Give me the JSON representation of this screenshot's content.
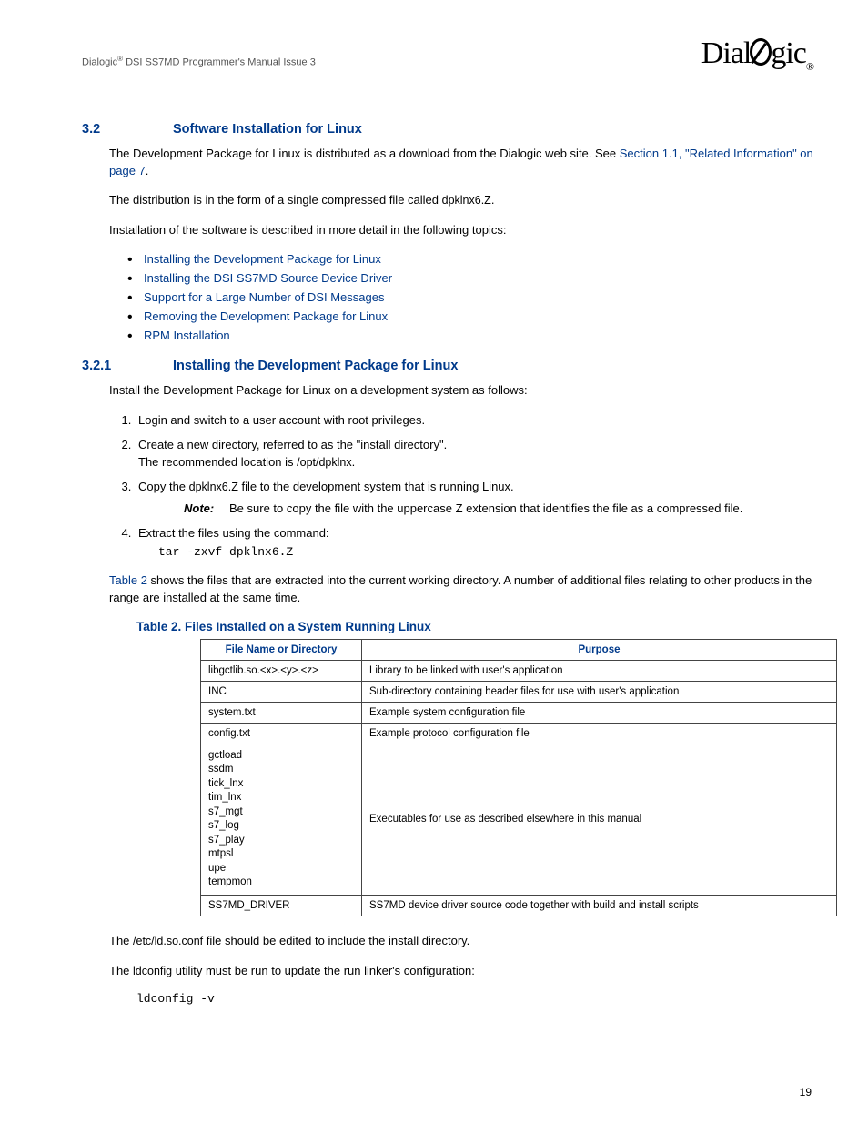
{
  "header": {
    "brand": "Dialogic",
    "doc": " DSI SS7MD Programmer's Manual  Issue 3",
    "logo_text_pre": "Dial",
    "logo_text_post": "gic",
    "reg": "®"
  },
  "s32": {
    "num": "3.2",
    "title": "Software Installation for Linux",
    "p1_a": "The Development Package for Linux is distributed as a download from the Dialogic web site. See ",
    "p1_link": "Section 1.1, \"Related Information\" on page 7",
    "p1_b": ".",
    "p2_a": "The distribution is in the form of a single compressed file called ",
    "p2_code": "dpklnx6.Z",
    "p2_b": ".",
    "p3": "Installation of the software is described in more detail in the following topics:",
    "bullets": [
      "Installing the Development Package for Linux",
      "Installing the DSI SS7MD Source Device Driver",
      "Support for a Large Number of DSI Messages",
      "Removing the Development Package for Linux",
      "RPM Installation"
    ]
  },
  "s321": {
    "num": "3.2.1",
    "title": "Installing the Development Package for Linux",
    "intro": "Install the Development Package for Linux on a development system as follows:",
    "steps": {
      "s1": "Login and switch to a user account with root privileges.",
      "s2_a": "Create a new directory, referred to as the \"install directory\".",
      "s2_b_pre": "The recommended location is ",
      "s2_b_code": "/opt/dpklnx",
      "s2_b_post": ".",
      "s3_pre": "Copy the ",
      "s3_code": "dpklnx6.Z",
      "s3_post": " file to the development system that is running Linux.",
      "note_label": "Note:",
      "note": "Be sure to copy the file with the uppercase Z extension that identifies the file as a compressed file.",
      "s4": "Extract the files using the command:",
      "s4_cmd": "tar -zxvf dpklnx6.Z"
    },
    "after_pre": "",
    "after_link": "Table 2",
    "after_post": " shows the files that are extracted into the current working directory. A number of additional files relating to other products in the range are installed at the same time."
  },
  "table": {
    "caption": "Table 2.  Files Installed on a System Running Linux",
    "h1": "File Name or Directory",
    "h2": "Purpose",
    "rows": [
      {
        "c1": "libgctlib.so.<x>.<y>.<z>",
        "c2": "Library to be linked with user's application"
      },
      {
        "c1": "INC",
        "c2": "Sub-directory containing header files for use with user's application"
      },
      {
        "c1": "system.txt",
        "c2": "Example system configuration file"
      },
      {
        "c1": "config.txt",
        "c2": "Example protocol configuration file"
      },
      {
        "c1": "gctload\nssdm\ntick_lnx\ntim_lnx\ns7_mgt\ns7_log\ns7_play\nmtpsl\nupe\ntempmon",
        "c2": "Executables for use as described elsewhere in this manual"
      },
      {
        "c1": "SS7MD_DRIVER",
        "c2": "SS7MD device driver source code together with build and install scripts"
      }
    ]
  },
  "tail": {
    "p1_pre": "The ",
    "p1_code": "/etc/ld.so.conf",
    "p1_post": " file should be edited to include the install directory.",
    "p2_pre": "The ",
    "p2_code": "ldconfig",
    "p2_post": " utility must be run to update the run linker's configuration:",
    "cmd": "ldconfig -v"
  },
  "page_number": "19"
}
